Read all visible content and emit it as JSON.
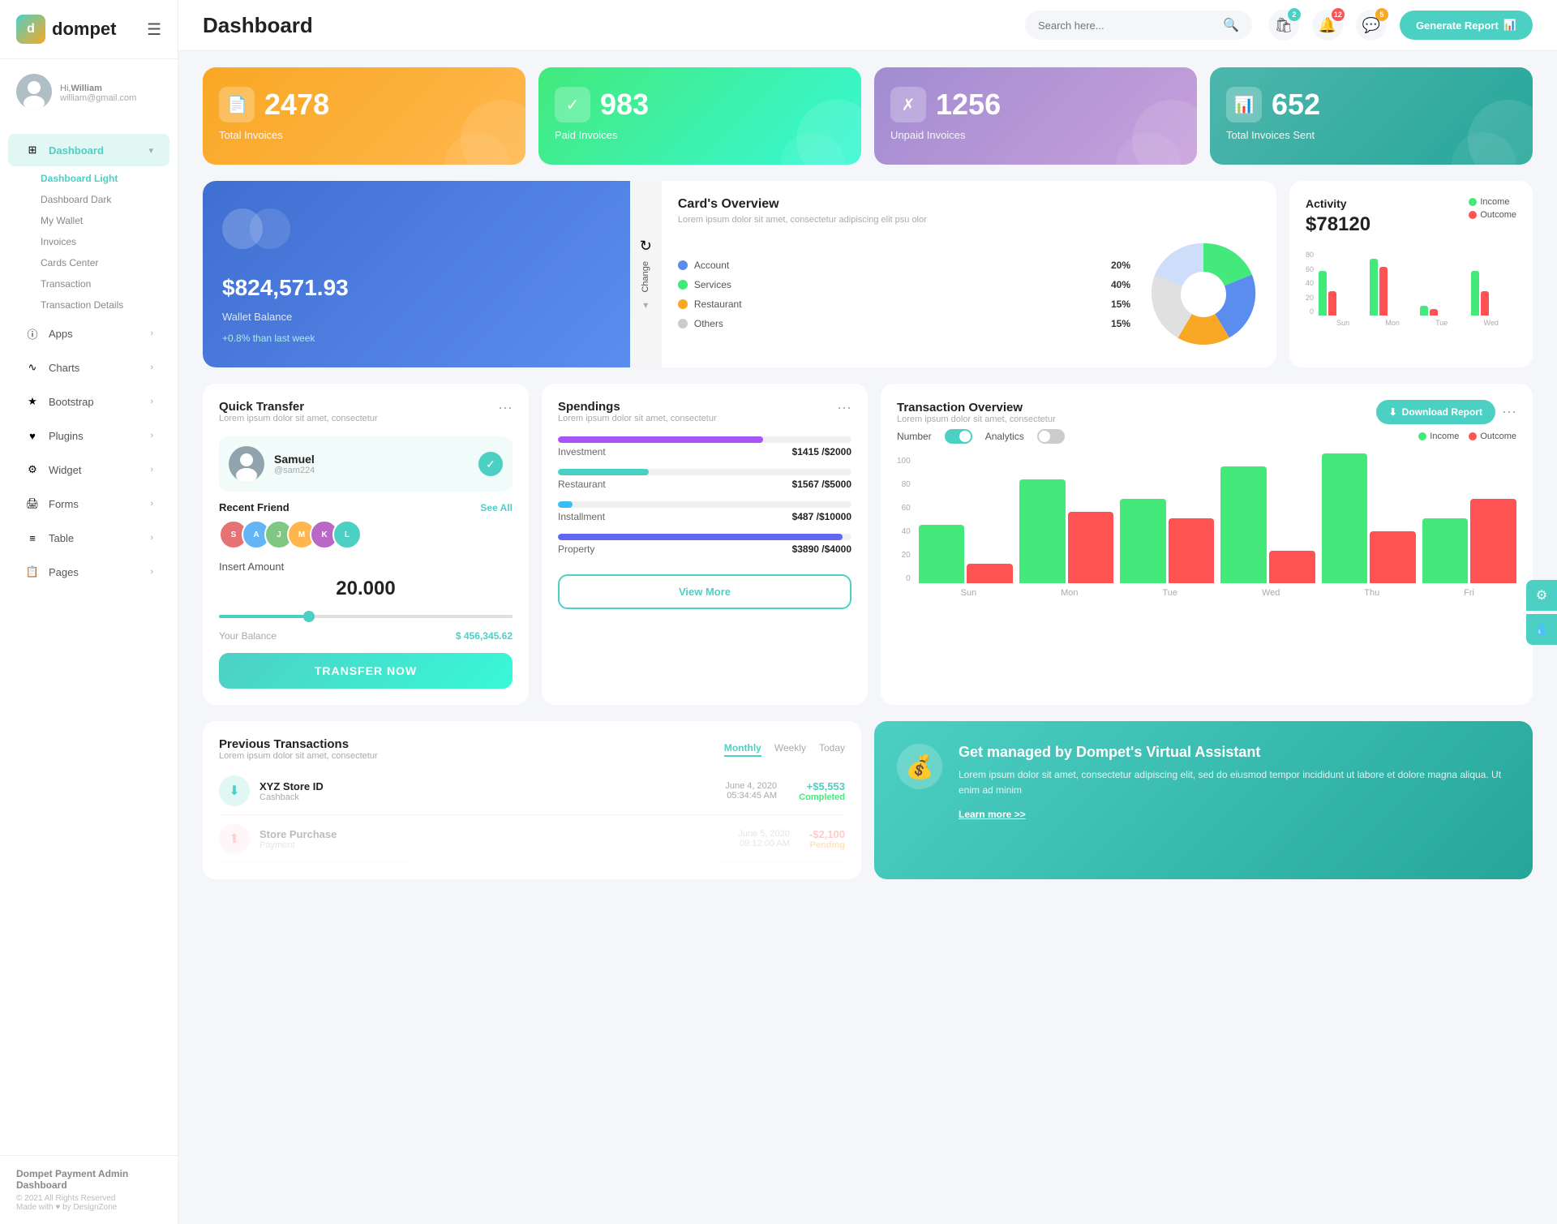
{
  "app": {
    "name": "dompet",
    "title": "Dashboard"
  },
  "header": {
    "search_placeholder": "Search here...",
    "generate_btn": "Generate Report",
    "badges": {
      "bag": "2",
      "bell": "12",
      "chat": "5"
    }
  },
  "user": {
    "greeting": "Hi,",
    "name": "William",
    "email": "william@gmail.com"
  },
  "sidebar": {
    "nav_items": [
      {
        "id": "dashboard",
        "label": "Dashboard",
        "icon": "⊞",
        "active": true,
        "arrow": "▾"
      },
      {
        "id": "apps",
        "label": "Apps",
        "icon": "ⓘ",
        "active": false,
        "arrow": "›"
      },
      {
        "id": "charts",
        "label": "Charts",
        "icon": "∿",
        "active": false,
        "arrow": "›"
      },
      {
        "id": "bootstrap",
        "label": "Bootstrap",
        "icon": "★",
        "active": false,
        "arrow": "›"
      },
      {
        "id": "plugins",
        "label": "Plugins",
        "icon": "♥",
        "active": false,
        "arrow": "›"
      },
      {
        "id": "widget",
        "label": "Widget",
        "icon": "⚙",
        "active": false,
        "arrow": "›"
      },
      {
        "id": "forms",
        "label": "Forms",
        "icon": "🖨",
        "active": false,
        "arrow": "›"
      },
      {
        "id": "table",
        "label": "Table",
        "icon": "≡",
        "active": false,
        "arrow": "›"
      },
      {
        "id": "pages",
        "label": "Pages",
        "icon": "📋",
        "active": false,
        "arrow": "›"
      }
    ],
    "sub_items": [
      {
        "label": "Dashboard Light",
        "active": true
      },
      {
        "label": "Dashboard Dark",
        "active": false
      },
      {
        "label": "My Wallet",
        "active": false
      },
      {
        "label": "Invoices",
        "active": false
      },
      {
        "label": "Cards Center",
        "active": false
      },
      {
        "label": "Transaction",
        "active": false
      },
      {
        "label": "Transaction Details",
        "active": false
      }
    ],
    "footer": {
      "company": "Dompet Payment Admin Dashboard",
      "copyright": "© 2021 All Rights Reserved",
      "made_with": "Made with ♥ by DesignZone"
    }
  },
  "stats": [
    {
      "id": "total-invoices",
      "number": "2478",
      "label": "Total Invoices",
      "color": "orange",
      "icon": "📄"
    },
    {
      "id": "paid-invoices",
      "number": "983",
      "label": "Paid Invoices",
      "color": "green",
      "icon": "✓"
    },
    {
      "id": "unpaid-invoices",
      "number": "1256",
      "label": "Unpaid Invoices",
      "color": "purple",
      "icon": "✗"
    },
    {
      "id": "total-sent",
      "number": "652",
      "label": "Total Invoices Sent",
      "color": "teal",
      "icon": "📊"
    }
  ],
  "wallet": {
    "amount": "$824,571.93",
    "label": "Wallet Balance",
    "change": "+0.8% than last week"
  },
  "cards_overview": {
    "title": "Card's Overview",
    "subtitle": "Lorem ipsum dolor sit amet, consectetur adipiscing elit psu olor",
    "legend": [
      {
        "label": "Account",
        "pct": "20%",
        "color": "#5b8dee"
      },
      {
        "label": "Services",
        "pct": "40%",
        "color": "#43e97b"
      },
      {
        "label": "Restaurant",
        "pct": "15%",
        "color": "#f9a825"
      },
      {
        "label": "Others",
        "pct": "15%",
        "color": "#ccc"
      }
    ],
    "pie_data": [
      {
        "label": "Account",
        "value": 20,
        "color": "#5b8dee"
      },
      {
        "label": "Services",
        "value": 40,
        "color": "#43e97b"
      },
      {
        "label": "Restaurant",
        "value": 15,
        "color": "#f9a825"
      },
      {
        "label": "Others",
        "value": 15,
        "color": "#ccc"
      }
    ]
  },
  "activity": {
    "title": "Activity",
    "amount": "$78120",
    "legend": [
      {
        "label": "Income",
        "color": "#43e97b"
      },
      {
        "label": "Outcome",
        "color": "#ff5252"
      }
    ],
    "chart_data": [
      {
        "day": "Sun",
        "income": 55,
        "outcome": 30
      },
      {
        "day": "Mon",
        "income": 70,
        "outcome": 60
      },
      {
        "day": "Tue",
        "income": 20,
        "outcome": 10
      },
      {
        "day": "Wed",
        "income": 65,
        "outcome": 40
      }
    ]
  },
  "quick_transfer": {
    "title": "Quick Transfer",
    "subtitle": "Lorem ipsum dolor sit amet, consectetur",
    "user": {
      "name": "Samuel",
      "handle": "@sam224"
    },
    "recent_friend_label": "Recent Friend",
    "see_all": "See All",
    "friends": [
      "S",
      "A",
      "J",
      "M",
      "K",
      "L"
    ],
    "friend_colors": [
      "#e57373",
      "#64b5f6",
      "#81c784",
      "#ffb74d",
      "#ba68c8",
      "#4dd0c4"
    ],
    "insert_amount_label": "Insert Amount",
    "amount": "20.000",
    "balance_label": "Your Balance",
    "balance": "$ 456,345.62",
    "transfer_btn": "TRANSFER NOW"
  },
  "spendings": {
    "title": "Spendings",
    "subtitle": "Lorem ipsum dolor sit amet, consectetur",
    "items": [
      {
        "name": "Investment",
        "amount": "$1415",
        "max": "$2000",
        "pct": 70,
        "color": "#a855f7"
      },
      {
        "name": "Restaurant",
        "amount": "$1567",
        "max": "$5000",
        "pct": 31,
        "color": "#4dd0c4"
      },
      {
        "name": "Installment",
        "amount": "$487",
        "max": "$10000",
        "pct": 5,
        "color": "#38bdf8"
      },
      {
        "name": "Property",
        "amount": "$3890",
        "max": "$4000",
        "pct": 97,
        "color": "#6366f1"
      }
    ],
    "view_more_btn": "View More"
  },
  "transaction_overview": {
    "title": "Transaction Overview",
    "subtitle": "Lorem ipsum dolor sit amet, consectetur",
    "download_btn": "Download Report",
    "toggles": [
      {
        "label": "Number",
        "active": true
      },
      {
        "label": "Analytics",
        "active": false
      }
    ],
    "legend": [
      {
        "label": "Income",
        "color": "#43e97b"
      },
      {
        "label": "Outcome",
        "color": "#ff5252"
      }
    ],
    "chart_data": [
      {
        "day": "Sun",
        "income": 45,
        "outcome": 15
      },
      {
        "day": "Mon",
        "income": 80,
        "outcome": 55
      },
      {
        "day": "Tue",
        "income": 65,
        "outcome": 50
      },
      {
        "day": "Wed",
        "income": 90,
        "outcome": 25
      },
      {
        "day": "Thu",
        "income": 100,
        "outcome": 40
      },
      {
        "day": "Fri",
        "income": 50,
        "outcome": 65
      }
    ],
    "y_labels": [
      "100",
      "80",
      "60",
      "40",
      "20",
      "0"
    ]
  },
  "previous_transactions": {
    "title": "Previous Transactions",
    "subtitle": "Lorem ipsum dolor sit amet, consectetur",
    "tabs": [
      "Monthly",
      "Weekly",
      "Today"
    ],
    "active_tab": "Monthly",
    "items": [
      {
        "name": "XYZ Store ID",
        "type": "Cashback",
        "date": "June 4, 2020",
        "time": "05:34:45 AM",
        "amount": "+$5,553",
        "status": "Completed",
        "icon": "⬇",
        "icon_color": "#4dd0c4"
      }
    ]
  },
  "virtual_assistant": {
    "title": "Get managed by Dompet's Virtual Assistant",
    "text": "Lorem ipsum dolor sit amet, consectetur adipiscing elit, sed do eiusmod tempor incididunt ut labore et dolore magna aliqua. Ut enim ad minim",
    "link": "Learn more >>",
    "icon": "💰"
  },
  "side_toolbar": {
    "gear": "⚙",
    "drop": "💧"
  }
}
